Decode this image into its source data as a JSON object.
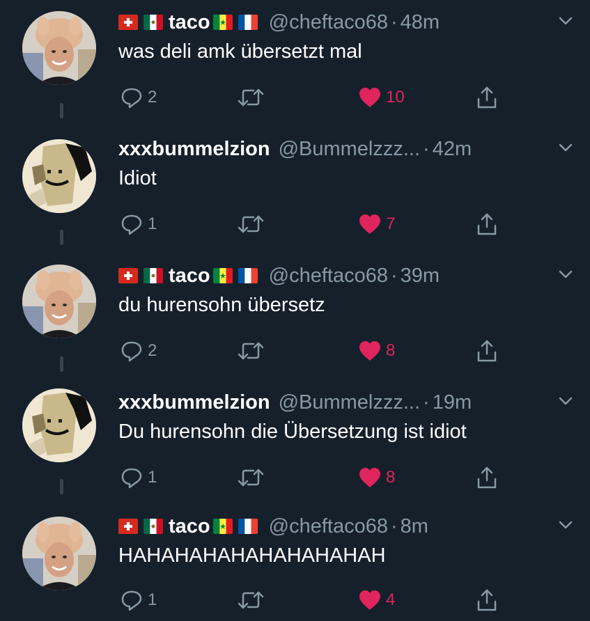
{
  "tweets": [
    {
      "display_name": "taco",
      "handle": "@cheftaco68",
      "separator": "·",
      "time": "48m",
      "text": "was deli amk übersetzt mal",
      "replies": "2",
      "likes": "10",
      "liked": true,
      "avatar": "taco-avatar",
      "flags_before": [
        "swiss-flag",
        "mexico-flag"
      ],
      "flags_after": [
        "senegal-flag",
        "france-flag"
      ]
    },
    {
      "display_name": "xxxbummelzion",
      "handle": "@Bummelzzz...",
      "separator": "·",
      "time": "42m",
      "text": "Idiot",
      "replies": "1",
      "likes": "7",
      "liked": true,
      "avatar": "bummel-avatar",
      "flags_before": [],
      "flags_after": []
    },
    {
      "display_name": "taco",
      "handle": "@cheftaco68",
      "separator": "·",
      "time": "39m",
      "text": "du hurensohn übersetz",
      "replies": "2",
      "likes": "8",
      "liked": true,
      "avatar": "taco-avatar",
      "flags_before": [
        "swiss-flag",
        "mexico-flag"
      ],
      "flags_after": [
        "senegal-flag",
        "france-flag"
      ]
    },
    {
      "display_name": "xxxbummelzion",
      "handle": "@Bummelzzz...",
      "separator": "·",
      "time": "19m",
      "text": "Du hurensohn die Übersetzung ist idiot",
      "replies": "1",
      "likes": "8",
      "liked": true,
      "avatar": "bummel-avatar",
      "flags_before": [],
      "flags_after": []
    },
    {
      "display_name": "taco",
      "handle": "@cheftaco68",
      "separator": "·",
      "time": "8m",
      "text": "HAHAHAHAHAHAHAHAHAH",
      "replies": "1",
      "likes": "4",
      "liked": true,
      "avatar": "taco-avatar",
      "flags_before": [
        "swiss-flag",
        "mexico-flag"
      ],
      "flags_after": [
        "senegal-flag",
        "france-flag"
      ]
    }
  ],
  "icons": {
    "reply": "reply-icon",
    "retweet": "retweet-icon",
    "like": "heart-icon",
    "share": "share-icon",
    "caret": "chevron-down-icon"
  },
  "colors": {
    "background": "#15202b",
    "text": "#ffffff",
    "secondary": "#8899a6",
    "like": "#e0245e",
    "thread_line": "#38444d"
  }
}
